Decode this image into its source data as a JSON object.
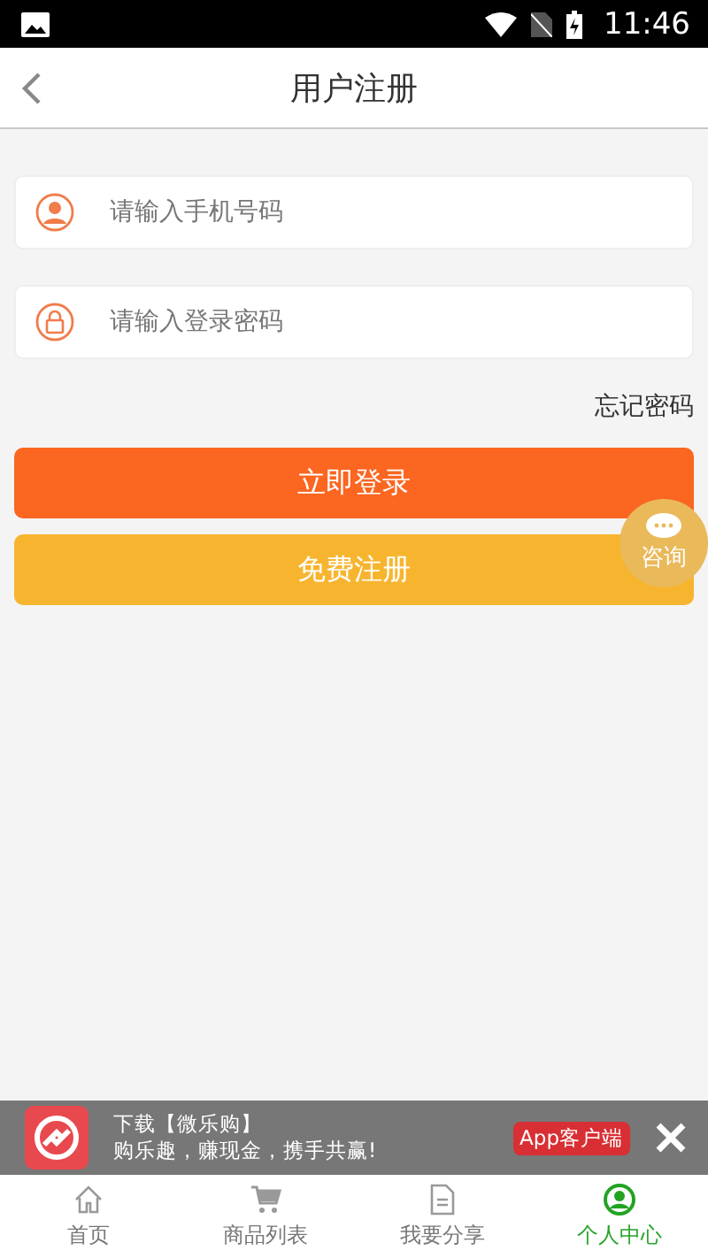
{
  "status_bar": {
    "time": "11:46"
  },
  "header": {
    "title": "用户注册"
  },
  "fields": [
    {
      "kind": "phone",
      "placeholder": "请输入手机号码"
    },
    {
      "kind": "password",
      "placeholder": "请输入登录密码"
    }
  ],
  "forgot_link": "忘记密码",
  "buttons": [
    {
      "kind": "primary",
      "label": "立即登录"
    },
    {
      "kind": "secondary",
      "label": "免费注册"
    }
  ],
  "consult_button": {
    "label": "咨询"
  },
  "app_banner": {
    "title": "下载【微乐购】",
    "subtitle": "购乐趣，赚现金，携手共赢!",
    "button": "App客户端"
  },
  "tabs": [
    {
      "kind": "home",
      "label": "首页",
      "selected": false
    },
    {
      "kind": "cart",
      "label": "商品列表",
      "selected": false
    },
    {
      "kind": "doc",
      "label": "我要分享",
      "selected": false
    },
    {
      "kind": "user",
      "label": "个人中心",
      "selected": true
    }
  ]
}
